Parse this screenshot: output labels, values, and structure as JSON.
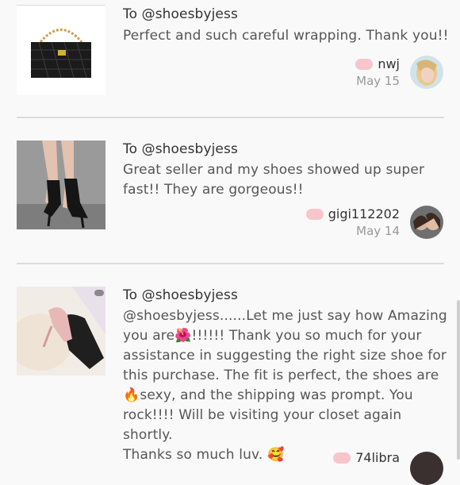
{
  "reviews": [
    {
      "to": "To @shoesbyjess",
      "message": "Perfect and such careful wrapping. Thank you!!",
      "user": "nwj",
      "date": "May 15",
      "image_icon": "black-quilted-handbag",
      "avatar_icon": "user-avatar-blonde"
    },
    {
      "to": "To @shoesbyjess",
      "message_lines": [
        "Great seller and my shoes showed up super",
        "fast!! They are gorgeous!!"
      ],
      "user": "gigi112202",
      "date": "May 14",
      "image_icon": "black-sock-heels",
      "avatar_icon": "user-avatar-two-people"
    },
    {
      "to": "To @shoesbyjess",
      "message_lines": [
        "@shoesbyjess......Let me just say how Amazing",
        "you are",
        "!!!!!! Thank you so much for your",
        "assistance in suggesting the right size shoe for",
        "this purchase. The fit is perfect, the shoes are",
        "sexy, and the shipping was prompt. You",
        "rock!!!! Will be visiting your closet again shortly.",
        "Thanks so much luv."
      ],
      "emojis": [
        "🌺",
        "🔥",
        "🥰"
      ],
      "user": "74libra",
      "image_icon": "pink-heels-on-fur",
      "avatar_icon": "user-avatar-dark"
    }
  ],
  "colors": {
    "background": "#f9f9f9",
    "heart": "#f9c5cc",
    "divider": "#dcdcdc"
  }
}
